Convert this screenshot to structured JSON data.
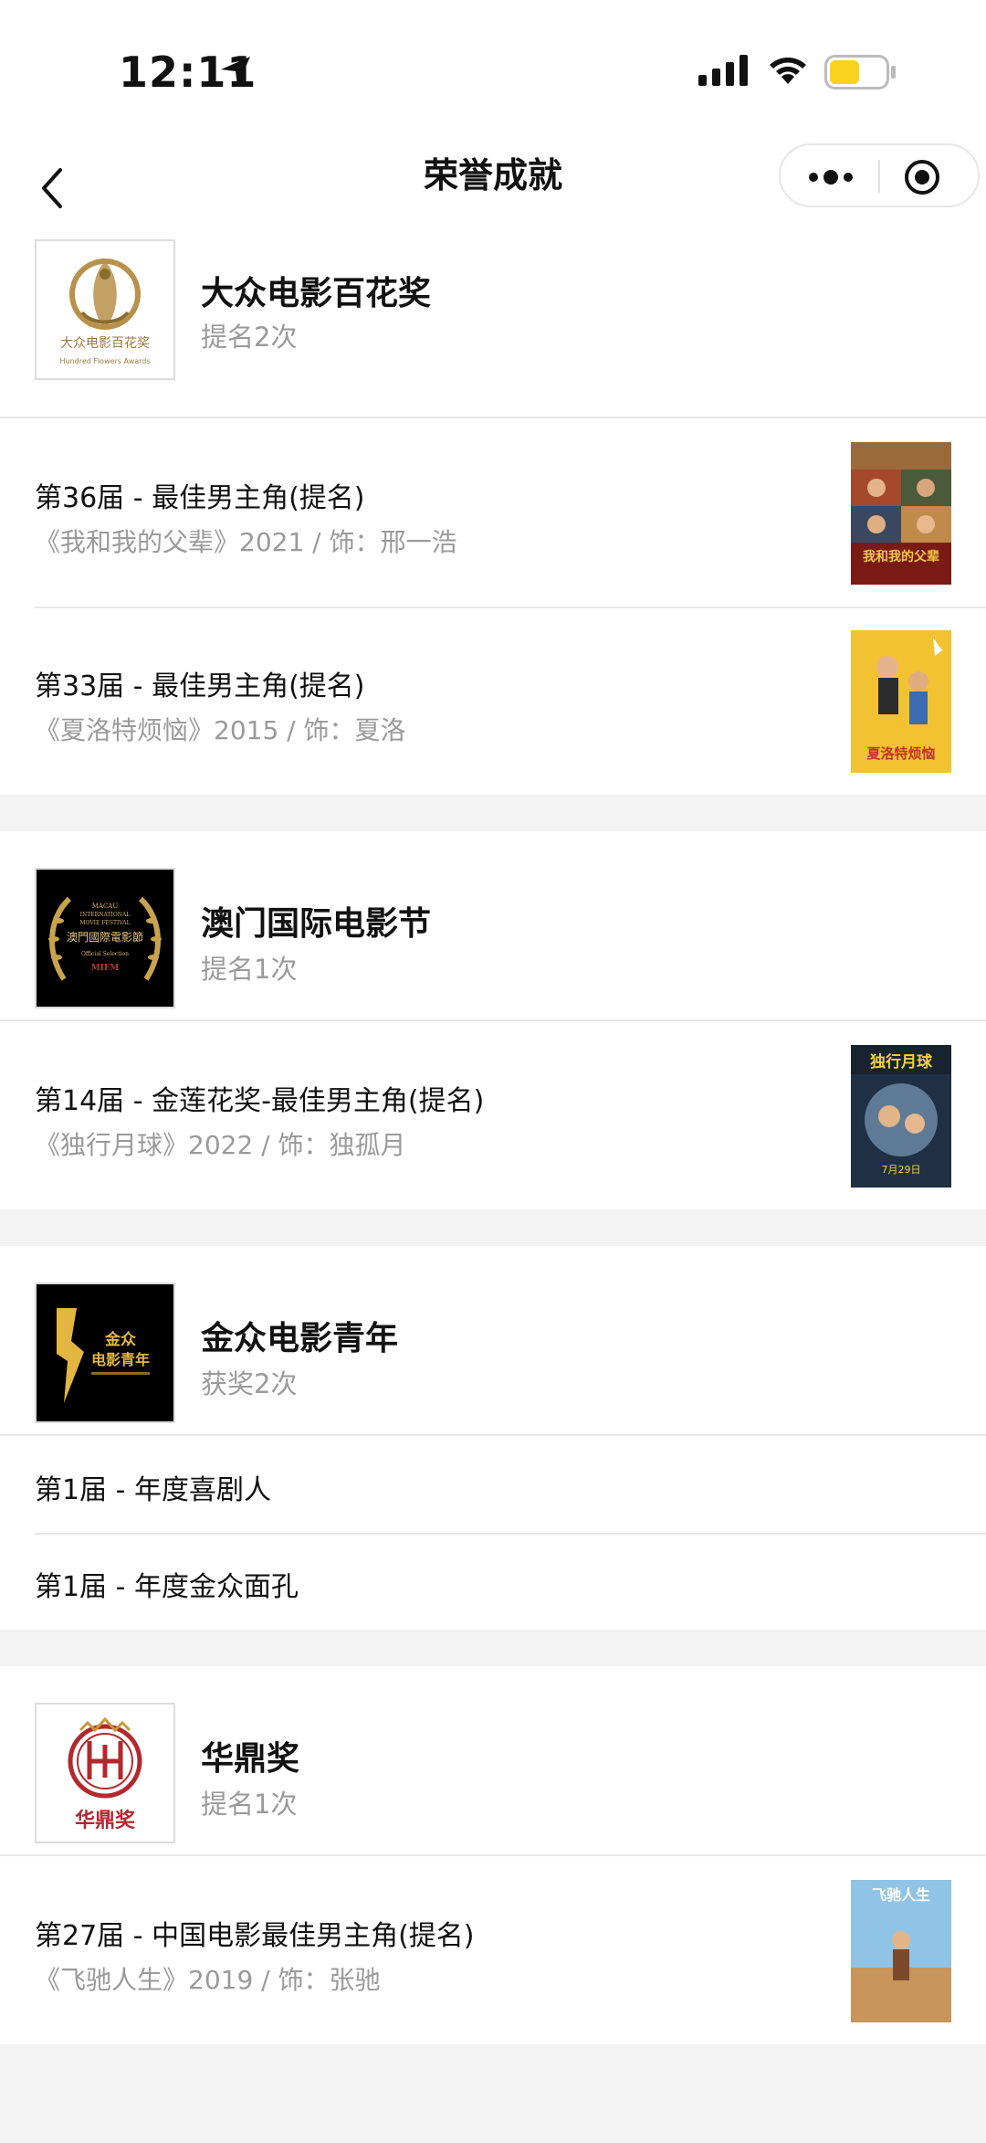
{
  "status": {
    "time": "12:11"
  },
  "nav": {
    "title": "荣誉成就"
  },
  "sections": [
    {
      "name": "大众电影百花奖",
      "count": "提名2次",
      "logo_text": "大众电影百花奖",
      "logo_subtext": "Hundred Flowers Awards",
      "awards": [
        {
          "title": "第36届 - 最佳男主角(提名)",
          "subtitle": "《我和我的父辈》2021 / 饰：邢一浩",
          "poster_text": "我和我的父辈"
        },
        {
          "title": "第33届 - 最佳男主角(提名)",
          "subtitle": "《夏洛特烦恼》2015 / 饰：夏洛",
          "poster_text": "夏洛特烦恼"
        }
      ]
    },
    {
      "name": "澳门国际电影节",
      "count": "提名1次",
      "logo_lines": [
        "MACAU",
        "INTERNATIONAL",
        "MOVIE FESTIVAL",
        "澳門國際電影節",
        "Official Selection",
        "MIFM"
      ],
      "awards": [
        {
          "title": "第14届 - 金莲花奖-最佳男主角(提名)",
          "subtitle": "《独行月球》2022 / 饰：独孤月",
          "poster_text": "独行月球",
          "poster_date": "7月29日"
        }
      ]
    },
    {
      "name": "金众电影青年",
      "count": "获奖2次",
      "logo_lines": [
        "金众",
        "电影青年"
      ],
      "awards": [
        {
          "title": "第1届 - 年度喜剧人"
        },
        {
          "title": "第1届 - 年度金众面孔"
        }
      ]
    },
    {
      "name": "华鼎奖",
      "count": "提名1次",
      "logo_text": "华鼎奖",
      "awards": [
        {
          "title": "第27届 - 中国电影最佳男主角(提名)",
          "subtitle": "《飞驰人生》2019 / 饰：张驰",
          "poster_text": "飞驰人生"
        }
      ]
    }
  ],
  "colors": {
    "battery": "#f7d21e",
    "gold": "#b8914a",
    "red": "#b3282d"
  }
}
